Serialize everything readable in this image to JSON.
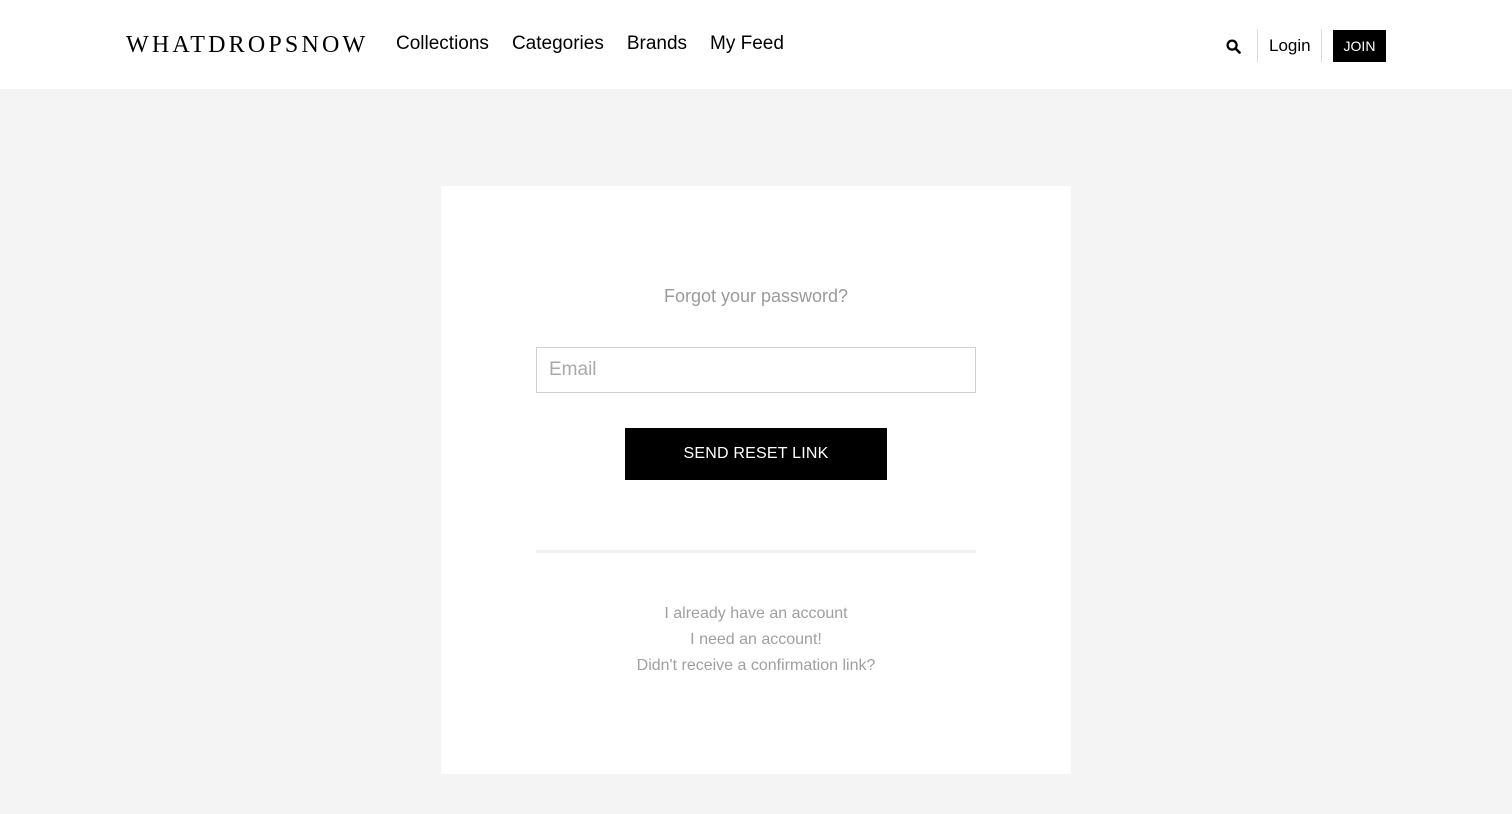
{
  "header": {
    "logo": "WHATDROPSNOW",
    "nav": [
      {
        "label": "Collections"
      },
      {
        "label": "Categories"
      },
      {
        "label": "Brands"
      },
      {
        "label": "My Feed"
      }
    ],
    "login_label": "Login",
    "join_label": "JOIN",
    "search_icon": "search-icon"
  },
  "form": {
    "title": "Forgot your password?",
    "email_placeholder": "Email",
    "email_value": "",
    "submit_label": "SEND RESET LINK"
  },
  "links": [
    {
      "label": "I already have an account"
    },
    {
      "label": "I need an account!"
    },
    {
      "label": "Didn't receive a confirmation link?"
    }
  ],
  "colors": {
    "background": "#f4f4f4",
    "card": "#ffffff",
    "primary_button": "#000000",
    "muted_text": "#9a9a9a"
  }
}
